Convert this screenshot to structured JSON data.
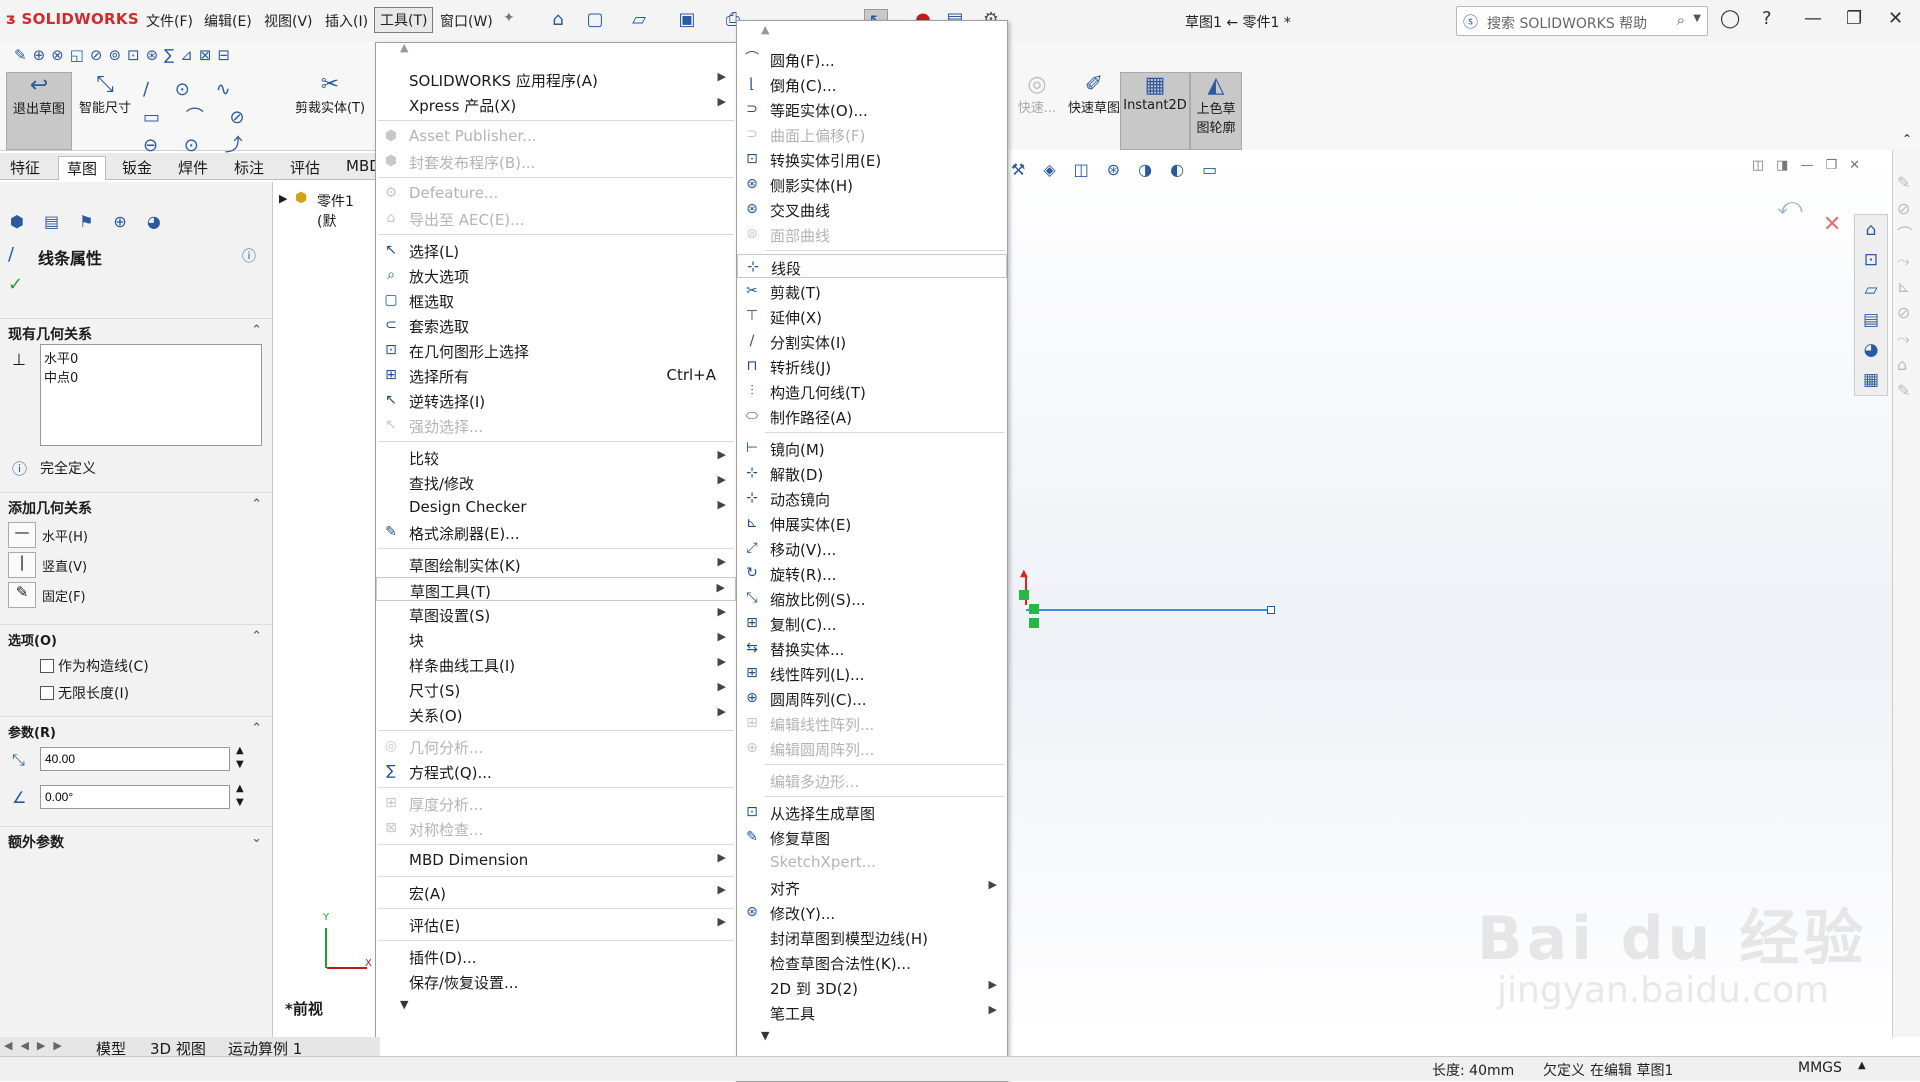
{
  "app": {
    "logo": "SOLIDWORKS",
    "doc_title": "草图1 ← 零件1 *"
  },
  "menubar": [
    "文件(F)",
    "编辑(E)",
    "视图(V)",
    "插入(I)",
    "工具(T)",
    "窗口(W)"
  ],
  "search": {
    "placeholder": "搜索 SOLIDWORKS 帮助"
  },
  "command_manager": {
    "exit_sketch": "退出草图",
    "smart_dim": "智能尺寸",
    "trim": "剪裁实体(T)",
    "quick": "快速...",
    "quick_sketch": "快速草图",
    "instant2d": "Instant2D",
    "shade": "上色草图轮廓"
  },
  "tabs": [
    "特征",
    "草图",
    "钣金",
    "焊件",
    "标注",
    "评估",
    "MBD"
  ],
  "tree": {
    "part": "零件1 (默"
  },
  "panel": {
    "title": "线条属性",
    "existing_rel": "现有几何关系",
    "rel_items": [
      "水平0",
      "中点0"
    ],
    "fully_defined": "完全定义",
    "add_rel": "添加几何关系",
    "add_items": [
      "水平(H)",
      "竖直(V)",
      "固定(F)"
    ],
    "options": "选项(O)",
    "opt_items": [
      "作为构造线(C)",
      "无限长度(I)"
    ],
    "params": "参数(R)",
    "length": "40.00",
    "angle": "0.00°",
    "extra": "额外参数"
  },
  "tools_menu": [
    {
      "label": "SOLIDWORKS 应用程序(A)",
      "sub": true
    },
    {
      "label": "Xpress 产品(X)",
      "sub": true
    },
    {
      "label": "Asset Publisher...",
      "dis": true
    },
    {
      "label": "封套发布程序(B)...",
      "dis": true
    },
    {
      "label": "Defeature...",
      "dis": true
    },
    {
      "label": "导出至 AEC(E)...",
      "dis": true
    },
    {
      "label": "选择(L)"
    },
    {
      "label": "放大选项"
    },
    {
      "label": "框选取"
    },
    {
      "label": "套索选取"
    },
    {
      "label": "在几何图形上选择"
    },
    {
      "label": "选择所有",
      "shortcut": "Ctrl+A"
    },
    {
      "label": "逆转选择(I)"
    },
    {
      "label": "强劲选择...",
      "dis": true
    },
    {
      "label": "比较",
      "sub": true
    },
    {
      "label": "查找/修改",
      "sub": true
    },
    {
      "label": "Design Checker",
      "sub": true
    },
    {
      "label": "格式涂刷器(E)..."
    },
    {
      "label": "草图绘制实体(K)",
      "sub": true
    },
    {
      "label": "草图工具(T)",
      "sub": true
    },
    {
      "label": "草图设置(S)",
      "sub": true
    },
    {
      "label": "块",
      "sub": true
    },
    {
      "label": "样条曲线工具(I)",
      "sub": true
    },
    {
      "label": "尺寸(S)",
      "sub": true
    },
    {
      "label": "关系(O)",
      "sub": true
    },
    {
      "label": "几何分析...",
      "dis": true
    },
    {
      "label": "方程式(Q)..."
    },
    {
      "label": "厚度分析...",
      "dis": true
    },
    {
      "label": "对称检查...",
      "dis": true
    },
    {
      "label": "MBD Dimension",
      "sub": true
    },
    {
      "label": "宏(A)",
      "sub": true
    },
    {
      "label": "评估(E)",
      "sub": true
    },
    {
      "label": "插件(D)..."
    },
    {
      "label": "保存/恢复设置..."
    }
  ],
  "sketch_tools_menu": [
    {
      "label": "圆角(F)..."
    },
    {
      "label": "倒角(C)..."
    },
    {
      "label": "等距实体(O)..."
    },
    {
      "label": "曲面上偏移(F)",
      "dis": true
    },
    {
      "label": "转换实体引用(E)"
    },
    {
      "label": "侧影实体(H)"
    },
    {
      "label": "交叉曲线"
    },
    {
      "label": "面部曲线",
      "dis": true
    },
    {
      "label": "线段"
    },
    {
      "label": "剪裁(T)"
    },
    {
      "label": "延伸(X)"
    },
    {
      "label": "分割实体(I)"
    },
    {
      "label": "转折线(J)"
    },
    {
      "label": "构造几何线(T)"
    },
    {
      "label": "制作路径(A)"
    },
    {
      "label": "镜向(M)"
    },
    {
      "label": "解散(D)"
    },
    {
      "label": "动态镜向"
    },
    {
      "label": "伸展实体(E)"
    },
    {
      "label": "移动(V)..."
    },
    {
      "label": "旋转(R)..."
    },
    {
      "label": "缩放比例(S)..."
    },
    {
      "label": "复制(C)..."
    },
    {
      "label": "替换实体..."
    },
    {
      "label": "线性阵列(L)..."
    },
    {
      "label": "圆周阵列(C)..."
    },
    {
      "label": "编辑线性阵列...",
      "dis": true
    },
    {
      "label": "编辑圆周阵列...",
      "dis": true
    },
    {
      "label": "编辑多边形...",
      "dis": true
    },
    {
      "label": "从选择生成草图"
    },
    {
      "label": "修复草图"
    },
    {
      "label": "SketchXpert...",
      "dis": true
    },
    {
      "label": "对齐",
      "sub": true
    },
    {
      "label": "修改(Y)..."
    },
    {
      "label": "封闭草图到模型边线(H)"
    },
    {
      "label": "检查草图合法性(K)..."
    },
    {
      "label": "2D 到 3D(2)",
      "sub": true
    },
    {
      "label": "笔工具",
      "sub": true
    }
  ],
  "view_label": "*前视",
  "bottom_tabs": [
    "模型",
    "3D 视图",
    "运动算例 1"
  ],
  "status": {
    "length": "长度: 40mm",
    "defined": "欠定义",
    "editing": "在编辑 草图1",
    "units": "MMGS"
  },
  "watermark": {
    "main": "Bai du 经验",
    "url": "jingyan.baidu.com"
  },
  "colors": {
    "accent": "#2b5aa0",
    "highlight": "#cce4f7",
    "line": "#3c8ee0"
  }
}
